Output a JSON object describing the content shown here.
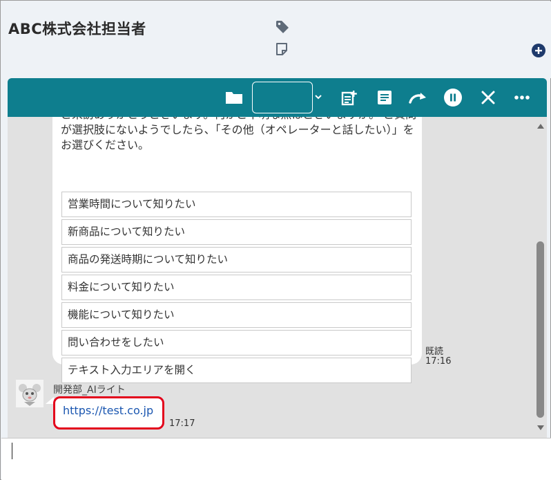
{
  "header": {
    "title": "ABC株式会社担当者",
    "icons": [
      "tag-icon",
      "note-icon",
      "add-circle-icon"
    ]
  },
  "toolbar": {
    "buttons": [
      "folder-icon",
      "add-document-icon",
      "text-document-icon",
      "forward-icon",
      "pause-icon",
      "close-icon",
      "more-icon"
    ],
    "select_value": "",
    "colors": {
      "bar": "#0e7e8e",
      "icon": "#ffffff"
    }
  },
  "chat": {
    "bot_message": {
      "text": "ご来訪ありがとうございます。何かご不明な点はございますか。 ご質問が選択肢にないようでしたら、「その他（オペレーターと話したい）」をお選びください。",
      "options": [
        "営業時間について知りたい",
        "新商品について知りたい",
        "商品の発送時期について知りたい",
        "料金について知りたい",
        "機能について知りたい",
        "問い合わせをしたい",
        "テキスト入力エリアを開く"
      ],
      "read_label": "既読",
      "time": "17:16"
    },
    "user_message": {
      "sender": "開発部_AIライト",
      "link_text": "https://test.co.jp",
      "time": "17:17",
      "highlight_color": "#e3001b"
    }
  },
  "input": {
    "value": ""
  }
}
